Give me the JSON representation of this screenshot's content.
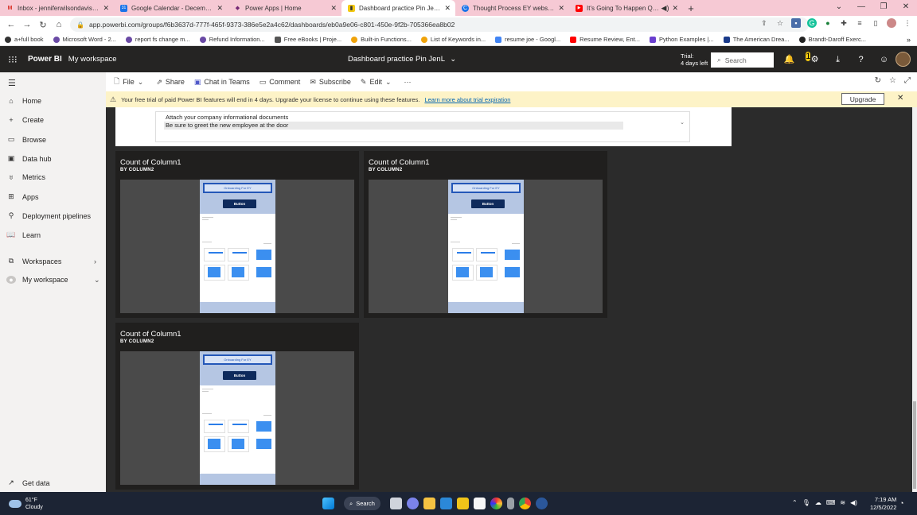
{
  "browser": {
    "tabs": [
      {
        "title": "Inbox - jenniferwilsondavis@gm...",
        "favicon_color": "#d93025",
        "favicon_text": "M",
        "active": false
      },
      {
        "title": "Google Calendar - December 20...",
        "favicon_color": "#1a73e8",
        "favicon_text": "31",
        "active": false
      },
      {
        "title": "Power Apps | Home",
        "favicon_color": "#742774",
        "favicon_text": "◆",
        "active": false
      },
      {
        "title": "Dashboard practice Pin JenL - Po...",
        "favicon_color": "#f2c811",
        "favicon_text": "▮",
        "active": true
      },
      {
        "title": "Thought Process EY website - Wi...",
        "favicon_color": "#1a73e8",
        "favicon_text": "C",
        "active": false
      },
      {
        "title": "It's Going To Happen Quickl...",
        "favicon_color": "#ff0000",
        "favicon_text": "▶",
        "active": false
      }
    ],
    "new_tab": "+",
    "url": "app.powerbi.com/groups/f6b3637d-777f-465f-9373-386e5e2a4c62/dashboards/eb0a9e06-c801-450e-9f2b-705366ea8b02",
    "bookmarks": [
      {
        "label": "a+full book",
        "color": "#333333"
      },
      {
        "label": "Microsoft Word - 2...",
        "color": "#6a4aa5"
      },
      {
        "label": "report fs change m...",
        "color": "#6a4aa5"
      },
      {
        "label": "Refund Information...",
        "color": "#6a4aa5"
      },
      {
        "label": "Free eBooks | Proje...",
        "color": "#555555"
      },
      {
        "label": "Built-in Functions...",
        "color": "#f0a30a"
      },
      {
        "label": "List of Keywords in...",
        "color": "#f0a30a"
      },
      {
        "label": "resume joe - Googl...",
        "color": "#4285f4"
      },
      {
        "label": "Resume Review, Ent...",
        "color": "#ff0000"
      },
      {
        "label": "Python Examples |...",
        "color": "#6a3fcf"
      },
      {
        "label": "The American Drea...",
        "color": "#1a3a8a"
      },
      {
        "label": "Brandt-Daroff Exerc...",
        "color": "#222222"
      }
    ],
    "bookmarks_more": "»"
  },
  "header": {
    "brand": "Power BI",
    "workspace": "My workspace",
    "title": "Dashboard practice Pin JenL",
    "trial_line1": "Trial:",
    "trial_line2": "4 days left",
    "search_placeholder": "Search",
    "notif_count": "1"
  },
  "nav": {
    "items": [
      {
        "label": "Home",
        "icon": "⌂"
      },
      {
        "label": "Create",
        "icon": "+"
      },
      {
        "label": "Browse",
        "icon": "▭"
      },
      {
        "label": "Data hub",
        "icon": "▣"
      },
      {
        "label": "Metrics",
        "icon": "♅"
      },
      {
        "label": "Apps",
        "icon": "⊞"
      },
      {
        "label": "Deployment pipelines",
        "icon": "⚲"
      },
      {
        "label": "Learn",
        "icon": "📖"
      }
    ],
    "workspaces": "Workspaces",
    "my_workspace": "My workspace",
    "get_data": "Get data"
  },
  "toolbar": {
    "file": "File",
    "share": "Share",
    "chat": "Chat in Teams",
    "comment": "Comment",
    "subscribe": "Subscribe",
    "edit": "Edit",
    "more": "···"
  },
  "banner": {
    "text": "Your free trial of paid Power BI features will end in 4 days. Upgrade your license to continue using these features.",
    "link": "Learn more about trial expiration",
    "upgrade": "Upgrade"
  },
  "top_tile": {
    "lines": [
      "Attach your company informational documents",
      "Be sure to greet the new employee at the door"
    ]
  },
  "tiles": [
    {
      "title": "Count of Column1",
      "subtitle": "BY COLUMN2",
      "mock_title": "Onboarding For EY",
      "mock_button": "Button"
    },
    {
      "title": "Count of Column1",
      "subtitle": "BY COLUMN2",
      "mock_title": "Onboarding For EY",
      "mock_button": "Button"
    },
    {
      "title": "Count of Column1",
      "subtitle": "BY COLUMN2",
      "mock_title": "Onboarding For EY",
      "mock_button": "Button"
    }
  ],
  "taskbar": {
    "temp": "61°F",
    "condition": "Cloudy",
    "search": "Search",
    "time": "7:19 AM",
    "date": "12/5/2022"
  }
}
